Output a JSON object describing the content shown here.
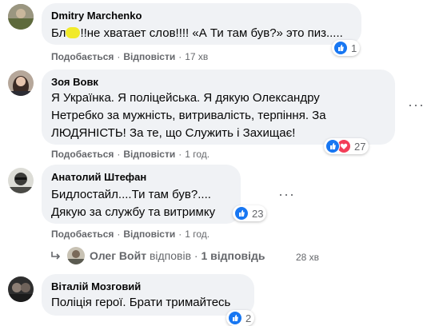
{
  "comments": [
    {
      "author": "Dmitry Marchenko",
      "text_lines": [
        "Бл",
        "!!не хватает слов!!!! «А Ти там був?» это пиз....."
      ],
      "like": "Подобається",
      "reply": "Відповісти",
      "time": "17 хв",
      "reactions": "1"
    },
    {
      "author": "Зоя Вовк",
      "text_lines": [
        "Я Українка. Я поліцейська. Я дякую Олександру",
        "Нетребко за мужність, витривалість, терпіння. За",
        "ЛЮДЯНІСТЬ! За те, що Служить і Захищає!"
      ],
      "like": "Подобається",
      "reply": "Відповісти",
      "time": "1 год.",
      "reactions": "27"
    },
    {
      "author": "Анатолий Штефан",
      "text_lines": [
        "Бидлостайл....Ти там був?....",
        "Дякую за службу та витримку"
      ],
      "like": "Подобається",
      "reply": "Відповісти",
      "time": "1 год.",
      "reactions": "23"
    },
    {
      "author": "Віталій Мозговий",
      "text_lines": [
        "Поліція герої. Брати тримайтесь"
      ],
      "reactions": "2"
    }
  ],
  "reply_summary": {
    "name": "Олег Войт",
    "verb": "відповів",
    "count": "1 відповідь",
    "time": "28 хв"
  },
  "colors": {
    "bubble": "#f0f2f5",
    "like_blue": "#1877f2",
    "love_red": "#f33e58",
    "secondary_text": "#65676b"
  }
}
